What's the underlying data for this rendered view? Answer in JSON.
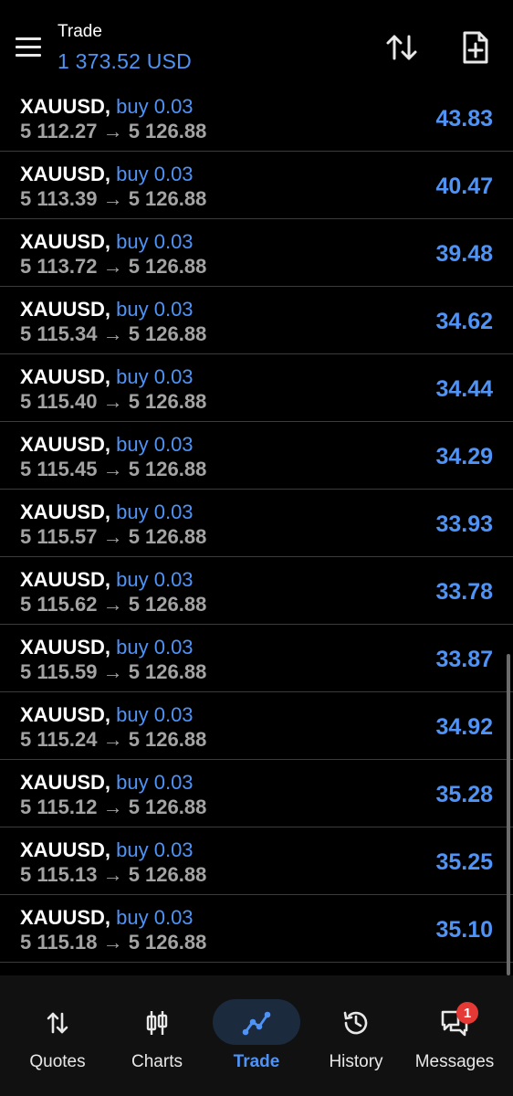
{
  "header": {
    "title": "Trade",
    "balance": "1 373.52 USD",
    "icons": {
      "menu": "hamburger-menu-icon",
      "sort": "sort-icon",
      "new_order": "new-document-icon"
    }
  },
  "positions": [
    {
      "symbol": "XAUUSD,",
      "order": "buy 0.03",
      "open_price": "5 112.27",
      "arrow": "→",
      "current_price": "5 126.88",
      "profit": "43.83"
    },
    {
      "symbol": "XAUUSD,",
      "order": "buy 0.03",
      "open_price": "5 113.39",
      "arrow": "→",
      "current_price": "5 126.88",
      "profit": "40.47"
    },
    {
      "symbol": "XAUUSD,",
      "order": "buy 0.03",
      "open_price": "5 113.72",
      "arrow": "→",
      "current_price": "5 126.88",
      "profit": "39.48"
    },
    {
      "symbol": "XAUUSD,",
      "order": "buy 0.03",
      "open_price": "5 115.34",
      "arrow": "→",
      "current_price": "5 126.88",
      "profit": "34.62"
    },
    {
      "symbol": "XAUUSD,",
      "order": "buy 0.03",
      "open_price": "5 115.40",
      "arrow": "→",
      "current_price": "5 126.88",
      "profit": "34.44"
    },
    {
      "symbol": "XAUUSD,",
      "order": "buy 0.03",
      "open_price": "5 115.45",
      "arrow": "→",
      "current_price": "5 126.88",
      "profit": "34.29"
    },
    {
      "symbol": "XAUUSD,",
      "order": "buy 0.03",
      "open_price": "5 115.57",
      "arrow": "→",
      "current_price": "5 126.88",
      "profit": "33.93"
    },
    {
      "symbol": "XAUUSD,",
      "order": "buy 0.03",
      "open_price": "5 115.62",
      "arrow": "→",
      "current_price": "5 126.88",
      "profit": "33.78"
    },
    {
      "symbol": "XAUUSD,",
      "order": "buy 0.03",
      "open_price": "5 115.59",
      "arrow": "→",
      "current_price": "5 126.88",
      "profit": "33.87"
    },
    {
      "symbol": "XAUUSD,",
      "order": "buy 0.03",
      "open_price": "5 115.24",
      "arrow": "→",
      "current_price": "5 126.88",
      "profit": "34.92"
    },
    {
      "symbol": "XAUUSD,",
      "order": "buy 0.03",
      "open_price": "5 115.12",
      "arrow": "→",
      "current_price": "5 126.88",
      "profit": "35.28"
    },
    {
      "symbol": "XAUUSD,",
      "order": "buy 0.03",
      "open_price": "5 115.13",
      "arrow": "→",
      "current_price": "5 126.88",
      "profit": "35.25"
    },
    {
      "symbol": "XAUUSD,",
      "order": "buy 0.03",
      "open_price": "5 115.18",
      "arrow": "→",
      "current_price": "5 126.88",
      "profit": "35.10"
    }
  ],
  "bottom_nav": {
    "items": [
      {
        "label": "Quotes",
        "icon": "quotes-arrows-icon"
      },
      {
        "label": "Charts",
        "icon": "candlestick-icon"
      },
      {
        "label": "Trade",
        "icon": "trend-line-icon",
        "active": true
      },
      {
        "label": "History",
        "icon": "history-clock-icon"
      },
      {
        "label": "Messages",
        "icon": "messages-chat-icon"
      }
    ],
    "messages_badge": "1"
  },
  "colors": {
    "background": "#000000",
    "accent": "#4e93f5",
    "secondary_text": "#a3a3a3",
    "badge": "#e53935"
  }
}
